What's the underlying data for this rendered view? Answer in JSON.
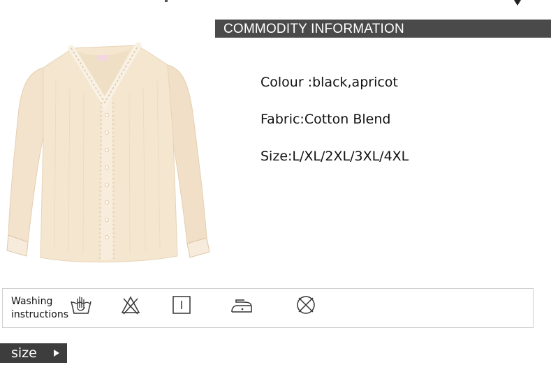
{
  "header": {
    "title": "COMMODITY INFORMATION"
  },
  "product": {
    "image_icon": "lace-trim-blouse-illustration",
    "colors": {
      "blouse": "#f3e3cc",
      "lace": "#f7ecdc",
      "shadow": "#dcc7a8"
    }
  },
  "specs": {
    "colour": "Colour :black,apricot",
    "fabric": "Fabric:Cotton Blend",
    "size": "Size:L/XL/2XL/3XL/4XL"
  },
  "washing": {
    "label_line1": "Washing",
    "label_line2": "instructions",
    "icons": [
      "hand-wash-icon",
      "do-not-bleach-icon",
      "tumble-dry-icon",
      "low-iron-icon",
      "do-not-dry-clean-icon"
    ]
  },
  "size_tag": {
    "label": "size"
  },
  "colors": {
    "title_bar": "#4a4a4a",
    "size_tag": "#3d3d3d",
    "border": "#cfcfcf"
  }
}
